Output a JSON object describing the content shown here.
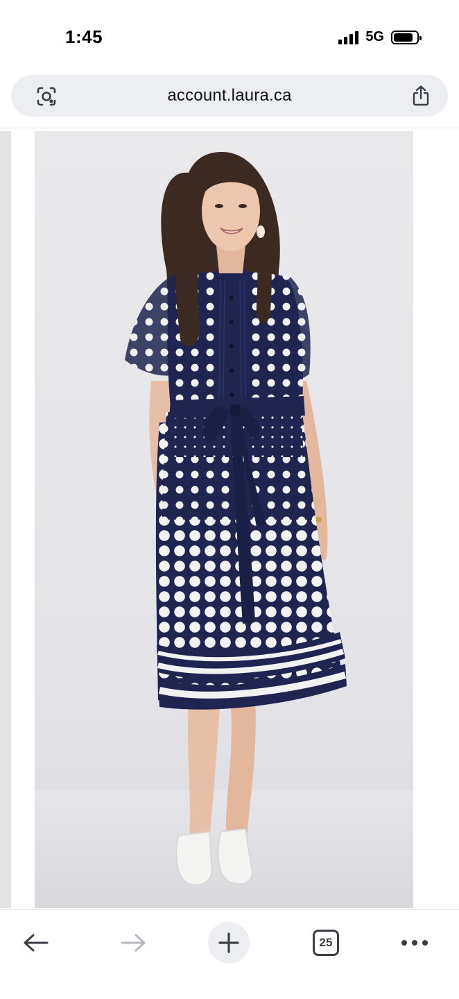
{
  "status_bar": {
    "time": "1:45",
    "network": "5G",
    "signal_bars": 4,
    "battery_level": 0.85
  },
  "url_bar": {
    "url": "account.laura.ca",
    "left_icon": "lens-icon",
    "right_icon": "share-icon"
  },
  "product_image": {
    "icon": "product-photo",
    "background_color": "#e6e6ea",
    "dress_color": "#1f2550",
    "dot_color": "#f2f2f2"
  },
  "toolbar": {
    "back_icon": "arrow-left-icon",
    "forward_icon": "arrow-right-icon",
    "new_tab_icon": "plus-icon",
    "tab_count": "25",
    "more_icon": "more-dots-icon"
  },
  "colors": {
    "url_bar_bg": "#eceef1",
    "icon_color": "#3a3f46",
    "disabled_icon": "#b5b9bf"
  }
}
